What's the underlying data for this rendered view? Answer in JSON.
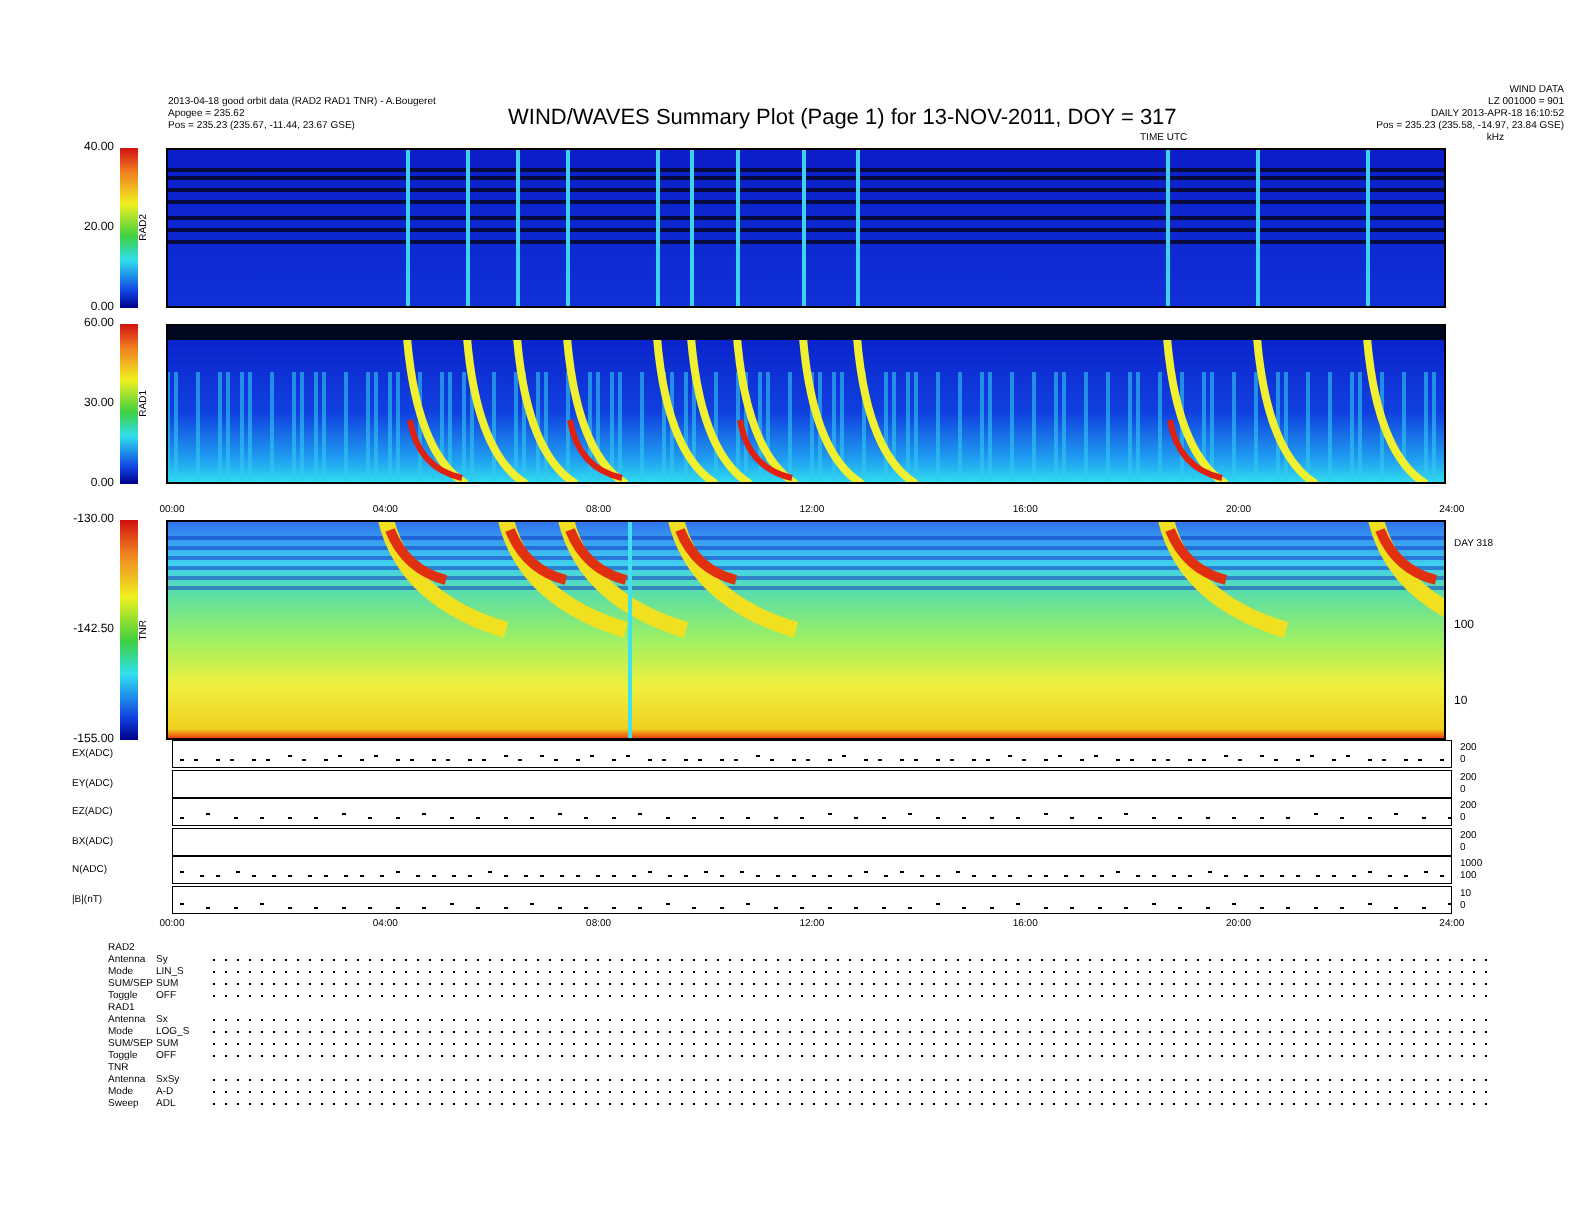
{
  "header": {
    "left_lines": [
      "2013-04-18 good orbit data (RAD2 RAD1 TNR) - A.Bougeret",
      "Apogee = 235.62",
      "Pos = 235.23 (235.67, -11.44, 23.67 GSE)"
    ],
    "title": "WIND/WAVES Summary Plot (Page 1) for 13-NOV-2011, DOY = 317",
    "right_lines": [
      "WIND DATA",
      "LZ 001000 = 901",
      "DAILY 2013-APR-18 16:10:52",
      "Pos = 235.23 (235.58, -14.97, 23.84 GSE)"
    ],
    "time_label": "TIME UTC",
    "corner_label": "kHz"
  },
  "panels": [
    {
      "kind": "rad",
      "name": "RAD2",
      "scale": [
        "40.00",
        "20.00",
        "0.00"
      ]
    },
    {
      "kind": "rad",
      "name": "RAD1",
      "scale": [
        "60.00",
        "30.00",
        "0.00"
      ]
    }
  ],
  "time_axis_top": [
    "00:00",
    "04:00",
    "08:00",
    "12:00",
    "16:00",
    "20:00",
    "24:00"
  ],
  "tnr": {
    "kind": "tnr",
    "name": "TNR",
    "scale": [
      "-130.00",
      "-142.50",
      "-155.00"
    ],
    "day_label": "DAY 318",
    "right_ticks": [
      "100",
      "10"
    ]
  },
  "traces": [
    {
      "label": "EX(ADC)",
      "ticks": [
        "200",
        "0"
      ]
    },
    {
      "label": "EY(ADC)",
      "ticks": [
        "200",
        "0"
      ]
    },
    {
      "label": "EZ(ADC)",
      "ticks": [
        "200",
        "0"
      ]
    },
    {
      "label": "BX(ADC)",
      "ticks": [
        "200",
        "0"
      ]
    },
    {
      "label": "N(ADC)",
      "ticks": [
        "1000",
        "100"
      ]
    },
    {
      "label": "|B|(nT)",
      "ticks": [
        "10",
        "0"
      ]
    }
  ],
  "time_axis_bottom": [
    "00:00",
    "04:00",
    "08:00",
    "12:00",
    "16:00",
    "20:00",
    "24:00"
  ],
  "status": [
    {
      "section": "RAD2",
      "rows": [
        {
          "label": "Antenna",
          "value": "Sy"
        },
        {
          "label": "Mode",
          "value": "LIN_S"
        },
        {
          "label": "SUM/SEP",
          "value": "SUM"
        },
        {
          "label": "Toggle",
          "value": "OFF"
        }
      ]
    },
    {
      "section": "RAD1",
      "rows": [
        {
          "label": "Antenna",
          "value": "Sx"
        },
        {
          "label": "Mode",
          "value": "LOG_S"
        },
        {
          "label": "SUM/SEP",
          "value": "SUM"
        },
        {
          "label": "Toggle",
          "value": "OFF"
        }
      ]
    },
    {
      "section": "TNR",
      "rows": [
        {
          "label": "Antenna",
          "value": "SxSy"
        },
        {
          "label": "Mode",
          "value": "A-D"
        },
        {
          "label": "Sweep",
          "value": "ADL"
        }
      ]
    }
  ]
}
